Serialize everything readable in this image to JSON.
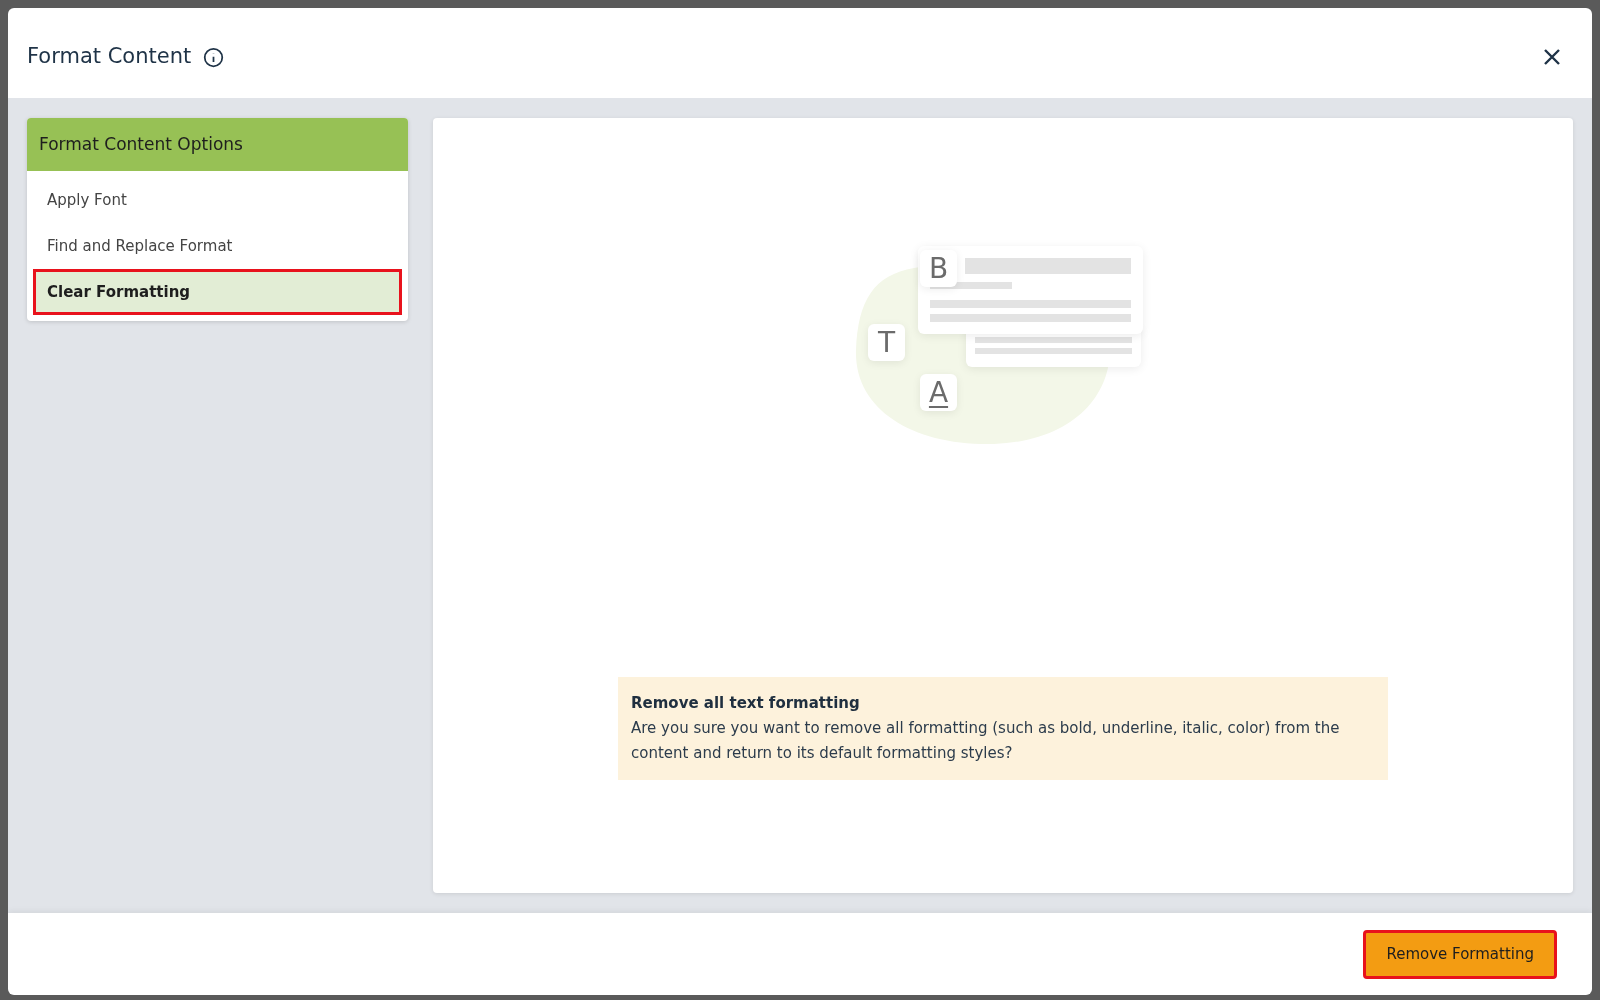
{
  "dialog": {
    "title": "Format Content"
  },
  "options": {
    "title": "Format Content Options",
    "items": [
      {
        "label": "Apply Font",
        "selected": false,
        "highlighted": false
      },
      {
        "label": "Find and Replace Format",
        "selected": false,
        "highlighted": false
      },
      {
        "label": "Clear Formatting",
        "selected": true,
        "highlighted": true
      }
    ]
  },
  "illustration": {
    "letters": [
      "B",
      "T",
      "A"
    ]
  },
  "notice": {
    "title": "Remove all text formatting",
    "text": "Are you sure you want to remove all formatting (such as bold, underline, italic, color) from the content and return to its default formatting styles?"
  },
  "footer": {
    "button": {
      "label": "Remove Formatting",
      "highlighted": true
    }
  }
}
